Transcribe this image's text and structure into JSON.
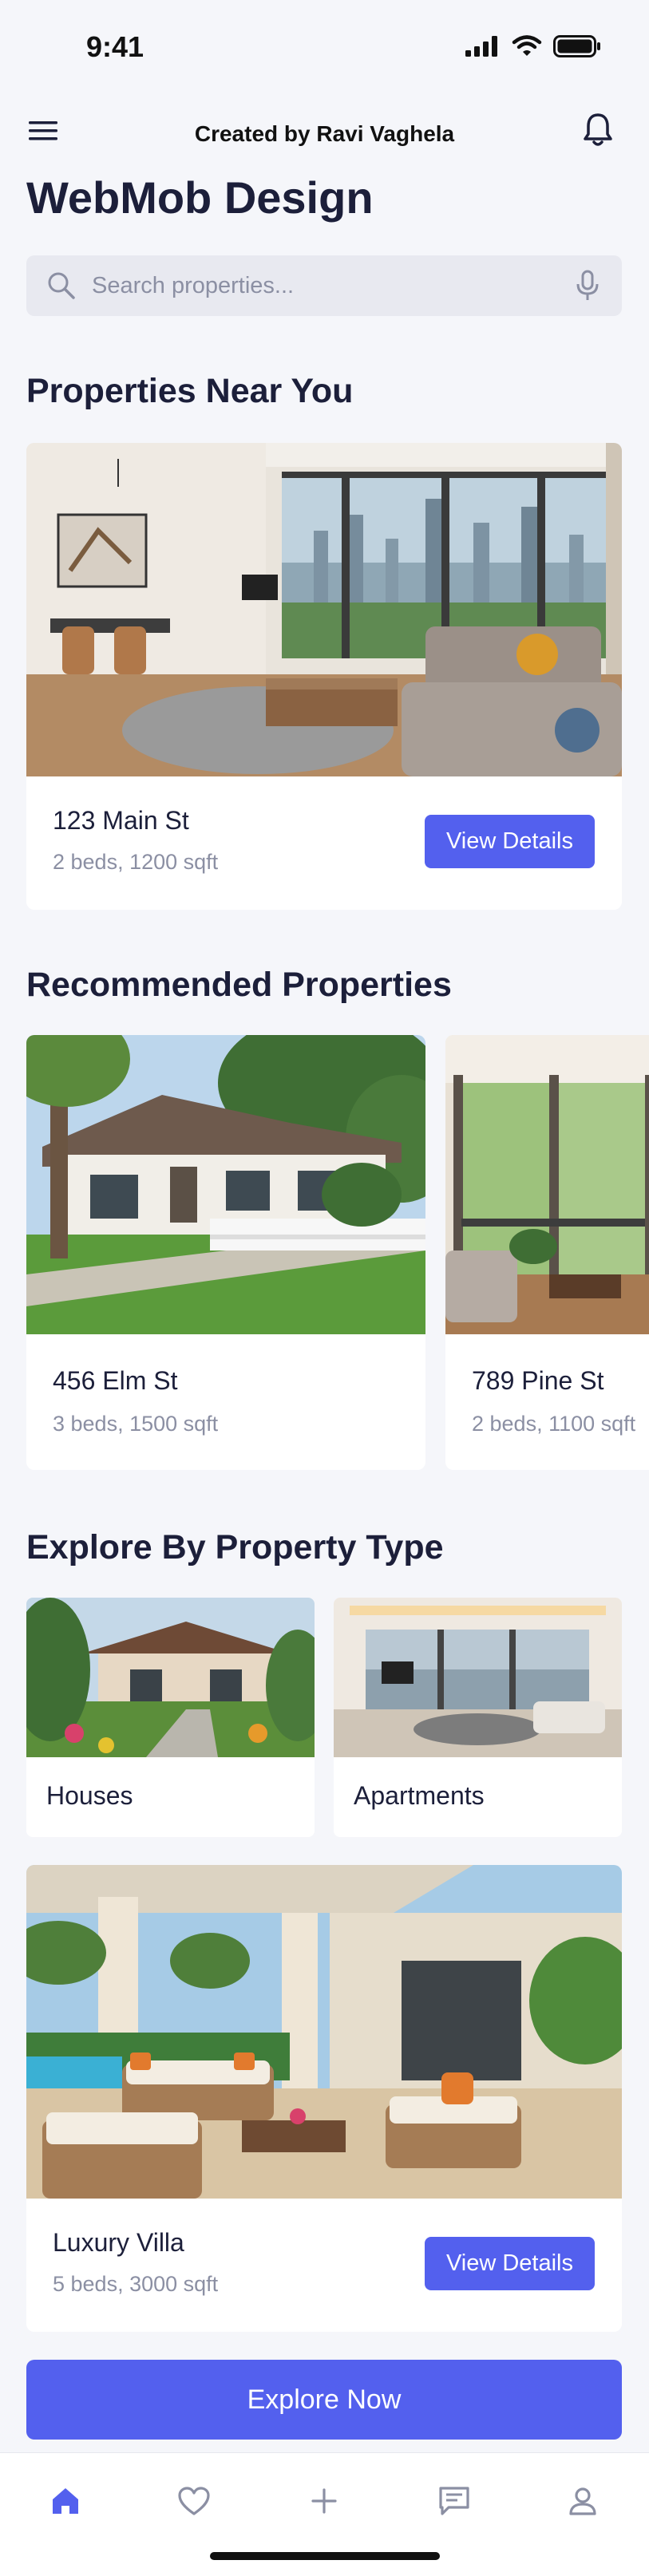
{
  "status_bar": {
    "time": "9:41"
  },
  "header": {
    "title": "Created by Ravi Vaghela"
  },
  "app_title": "WebMob Design",
  "search": {
    "placeholder": "Search properties..."
  },
  "near_you": {
    "title": "Properties Near You",
    "card": {
      "address": "123 Main St",
      "details": "2 beds, 1200 sqft",
      "button": "View Details"
    }
  },
  "recommended": {
    "title": "Recommended Properties",
    "items": [
      {
        "address": "456 Elm St",
        "details": "3 beds, 1500 sqft"
      },
      {
        "address": "789 Pine St",
        "details": "2 beds, 1100 sqft"
      }
    ]
  },
  "explore_type": {
    "title": "Explore By Property Type",
    "types": [
      {
        "label": "Houses"
      },
      {
        "label": "Apartments"
      }
    ],
    "featured": {
      "name": "Luxury Villa",
      "details": "5 beds, 3000 sqft",
      "button": "View Details"
    }
  },
  "explore_button": "Explore Now",
  "bottom_nav": [
    {
      "icon": "home-icon",
      "active": true
    },
    {
      "icon": "heart-icon",
      "active": false
    },
    {
      "icon": "plus-icon",
      "active": false
    },
    {
      "icon": "message-icon",
      "active": false
    },
    {
      "icon": "profile-icon",
      "active": false
    }
  ],
  "colors": {
    "accent": "#5360ee",
    "background": "#f5f6fa",
    "text": "#1c1f3a",
    "muted": "#8b8fa3"
  }
}
